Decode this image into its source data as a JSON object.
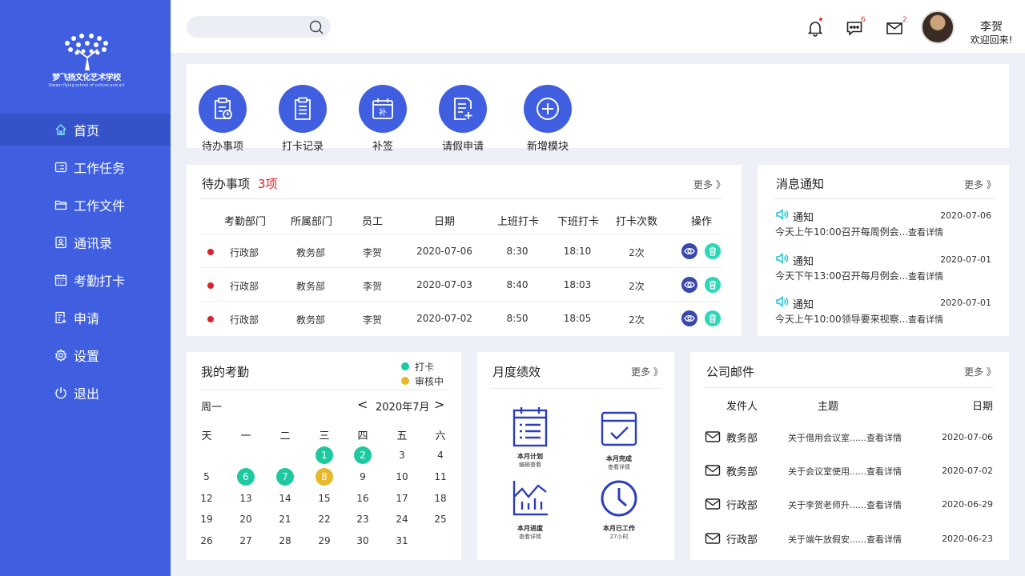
{
  "logo": {
    "title": "梦飞扬文化艺术学校",
    "subtitle": "Dream flying school of culture and art"
  },
  "nav": [
    {
      "label": "首页",
      "icon": "home-icon"
    },
    {
      "label": "工作任务",
      "icon": "task-icon"
    },
    {
      "label": "工作文件",
      "icon": "folder-icon"
    },
    {
      "label": "通讯录",
      "icon": "contacts-icon"
    },
    {
      "label": "考勤打卡",
      "icon": "calendar-icon"
    },
    {
      "label": "申请",
      "icon": "apply-icon"
    },
    {
      "label": "设置",
      "icon": "gear-icon"
    },
    {
      "label": "退出",
      "icon": "power-icon"
    }
  ],
  "header": {
    "search_placeholder": "",
    "messages_badge": "6",
    "mail_badge": "2",
    "user_name": "李贺",
    "greeting": "欢迎回来!"
  },
  "quick_actions": [
    {
      "label": "待办事项",
      "icon": "clipboard-clock-icon"
    },
    {
      "label": "打卡记录",
      "icon": "record-list-icon"
    },
    {
      "label": "补签",
      "icon": "calendar-supplement-icon"
    },
    {
      "label": "请假申请",
      "icon": "leave-form-icon"
    },
    {
      "label": "新增模块",
      "icon": "add-circle-icon"
    }
  ],
  "todo": {
    "title": "待办事项",
    "count": "3项",
    "more": "更多 》",
    "columns": [
      "考勤部门",
      "所属部门",
      "员工",
      "日期",
      "上班打卡",
      "下班打卡",
      "打卡次数",
      "操作"
    ],
    "rows": [
      [
        "行政部",
        "教务部",
        "李贺",
        "2020-07-06",
        "8:30",
        "18:10",
        "2次"
      ],
      [
        "行政部",
        "教务部",
        "李贺",
        "2020-07-03",
        "8:40",
        "18:03",
        "2次"
      ],
      [
        "行政部",
        "教务部",
        "李贺",
        "2020-07-02",
        "8:50",
        "18:05",
        "2次"
      ]
    ]
  },
  "notices": {
    "title": "消息通知",
    "more": "更多 》",
    "items": [
      {
        "type": "通知",
        "date": "2020-07-06",
        "content": "今天上午10:00召开每周例会...",
        "link": "查看详情"
      },
      {
        "type": "通知",
        "date": "2020-07-01",
        "content": "今天下午13:00召开每月例会...",
        "link": "查看详情"
      },
      {
        "type": "通知",
        "date": "2020-07-01",
        "content": "今天上午10:00领导要来视察...",
        "link": "查看详情"
      }
    ]
  },
  "attendance": {
    "title": "我的考勤",
    "legend": [
      {
        "label": "打卡",
        "color": "#1fc9a0"
      },
      {
        "label": "审核中",
        "color": "#e6b82a"
      }
    ],
    "week_label": "周一",
    "month": "2020年7月",
    "prev": "<",
    "next": ">",
    "weekdays": [
      "天",
      "一",
      "二",
      "三",
      "四",
      "五",
      "六"
    ],
    "weeks": [
      [
        "",
        "",
        "",
        "1",
        "2",
        "3",
        "4"
      ],
      [
        "5",
        "6",
        "7",
        "8",
        "9",
        "10",
        "11"
      ],
      [
        "12",
        "13",
        "14",
        "15",
        "16",
        "17",
        "18"
      ],
      [
        "19",
        "20",
        "21",
        "22",
        "23",
        "24",
        "25"
      ],
      [
        "26",
        "27",
        "28",
        "29",
        "30",
        "31",
        ""
      ]
    ],
    "checked_in_days": [
      "1",
      "2",
      "6",
      "7"
    ],
    "pending_days": [
      "8"
    ]
  },
  "performance": {
    "title": "月度绩效",
    "more": "更多 》",
    "items": [
      {
        "title": "本月计划",
        "sub": "编辑查看",
        "icon": "plan-icon"
      },
      {
        "title": "本月完成",
        "sub": "查看详情",
        "icon": "check-calendar-icon"
      },
      {
        "title": "本月进度",
        "sub": "查看详情",
        "icon": "progress-chart-icon"
      },
      {
        "title": "本月已工作",
        "sub": "27小时",
        "icon": "clock-icon"
      }
    ]
  },
  "mail": {
    "title": "公司邮件",
    "more": "更多 》",
    "columns": [
      "发件人",
      "主题",
      "日期"
    ],
    "rows": [
      {
        "sender": "教务部",
        "subject": "关于借用会议室......查看详情",
        "date": "2020-07-06"
      },
      {
        "sender": "教务部",
        "subject": "关于会议室使用......查看详情",
        "date": "2020-07-02"
      },
      {
        "sender": "行政部",
        "subject": "关于李贺老师升......查看详情",
        "date": "2020-06-29"
      },
      {
        "sender": "行政部",
        "subject": "关于端午放假安......查看详情",
        "date": "2020-06-23"
      }
    ]
  },
  "colors": {
    "primary": "#3f5fe0",
    "active_nav": "#3553c9",
    "danger": "#d8232a",
    "check_in": "#1fc9a0",
    "pending": "#e6b82a"
  }
}
